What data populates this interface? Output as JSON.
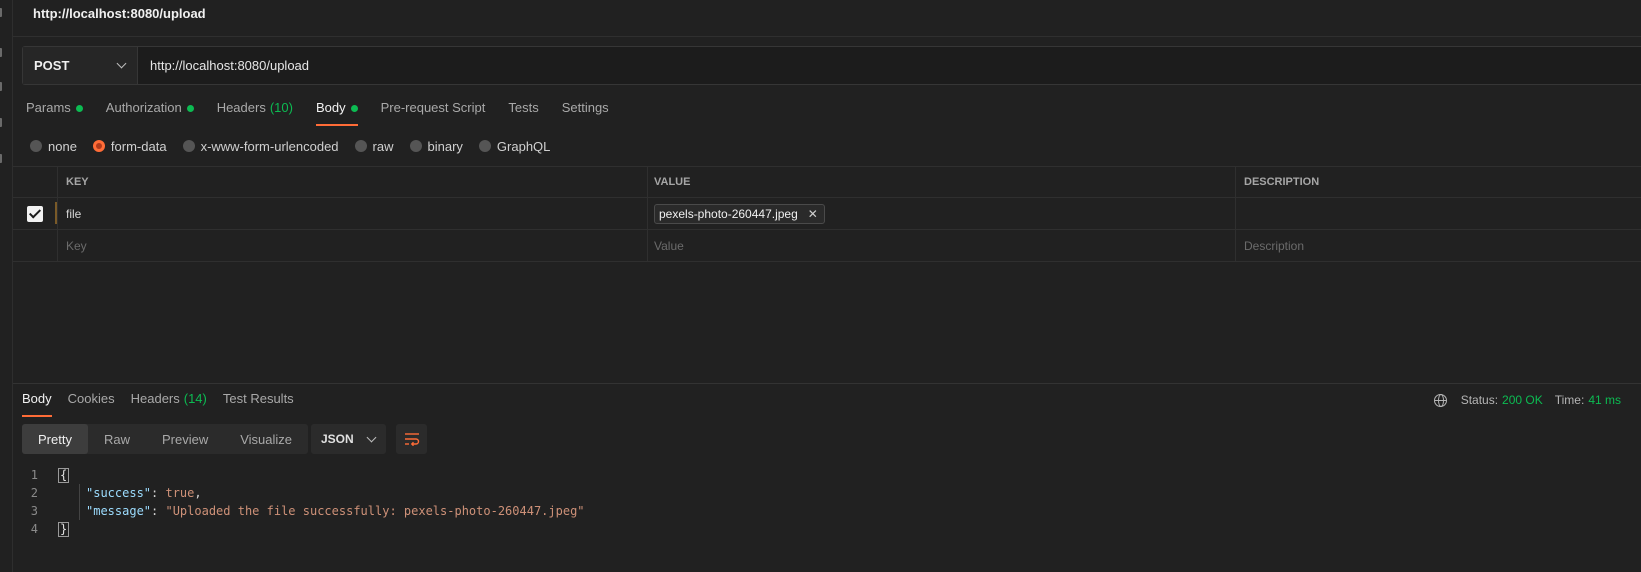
{
  "title": "http://localhost:8080/upload",
  "request": {
    "method": "POST",
    "url": "http://localhost:8080/upload"
  },
  "request_tabs": [
    {
      "label": "Params",
      "dot": true
    },
    {
      "label": "Authorization",
      "dot": true
    },
    {
      "label": "Headers",
      "count": "(10)"
    },
    {
      "label": "Body",
      "dot": true,
      "active": true
    },
    {
      "label": "Pre-request Script"
    },
    {
      "label": "Tests"
    },
    {
      "label": "Settings"
    }
  ],
  "body_types": [
    "none",
    "form-data",
    "x-www-form-urlencoded",
    "raw",
    "binary",
    "GraphQL"
  ],
  "body_type_selected": "form-data",
  "table": {
    "headers": [
      "KEY",
      "VALUE",
      "DESCRIPTION"
    ],
    "rows": [
      {
        "checked": true,
        "key": "file",
        "value": "pexels-photo-260447.jpeg",
        "description": ""
      }
    ],
    "placeholders": {
      "key": "Key",
      "value": "Value",
      "description": "Description"
    }
  },
  "response_tabs": [
    {
      "label": "Body",
      "active": true
    },
    {
      "label": "Cookies"
    },
    {
      "label": "Headers",
      "count": "(14)"
    },
    {
      "label": "Test Results"
    }
  ],
  "response_meta": {
    "status_label": "Status:",
    "status_value": "200 OK",
    "time_label": "Time:",
    "time_value": "41 ms"
  },
  "view_modes": [
    "Pretty",
    "Raw",
    "Preview",
    "Visualize"
  ],
  "view_mode_selected": "Pretty",
  "format": "JSON",
  "code": {
    "line_numbers": [
      "1",
      "2",
      "3",
      "4"
    ],
    "open": "{",
    "close": "}",
    "success_key": "\"success\"",
    "success_value": "true",
    "message_key": "\"message\"",
    "message_value": "\"Uploaded the file successfully: pexels-photo-260447.jpeg\""
  },
  "colors": {
    "accent": "#ff6c37",
    "success": "#0cbb52",
    "background": "#212121"
  }
}
